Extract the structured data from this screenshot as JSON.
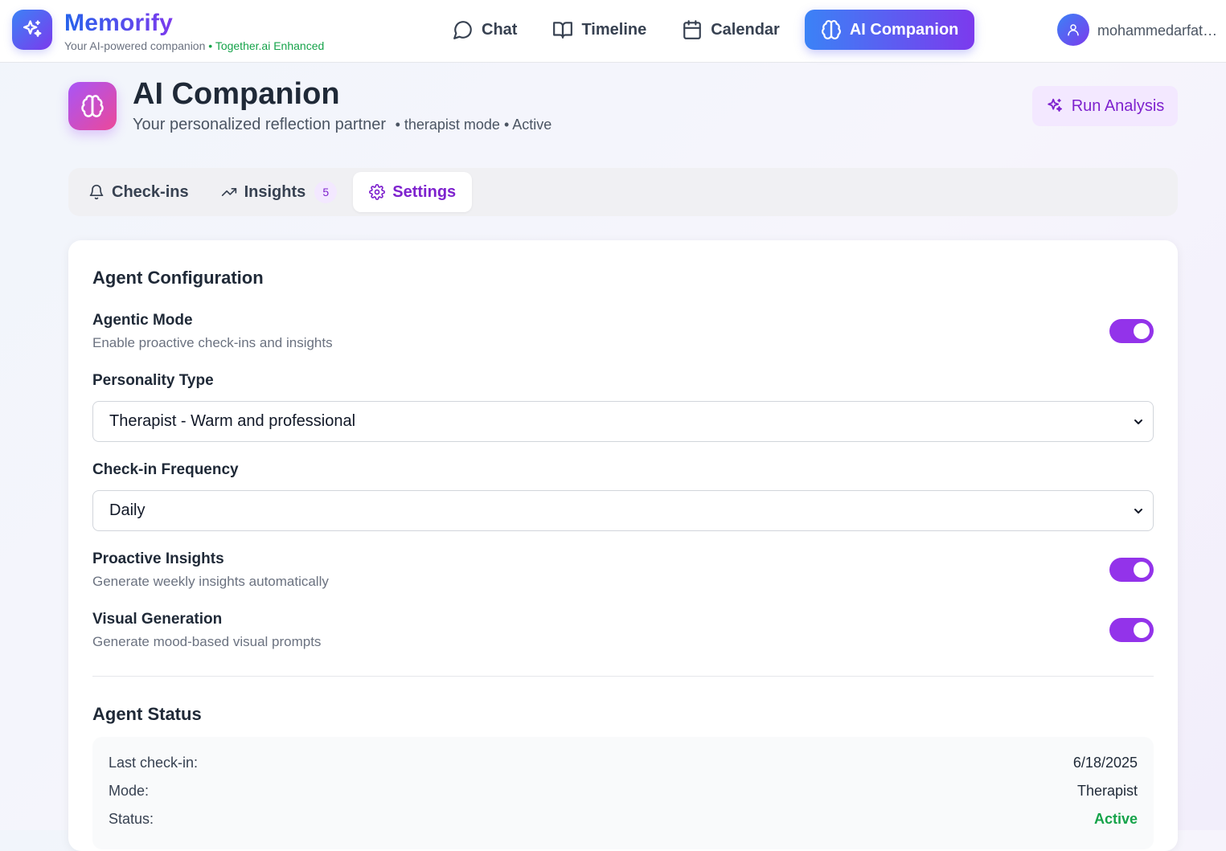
{
  "app": {
    "name": "Memorify",
    "tagline": "Your AI-powered companion",
    "enhanced": "• Together.ai Enhanced"
  },
  "nav": {
    "items": [
      {
        "label": "Chat",
        "icon": "chat-bubble-icon"
      },
      {
        "label": "Timeline",
        "icon": "book-open-icon"
      },
      {
        "label": "Calendar",
        "icon": "calendar-icon"
      },
      {
        "label": "AI Companion",
        "icon": "brain-icon",
        "active": true
      }
    ],
    "user": "mohammedarfath..."
  },
  "page": {
    "title": "AI Companion",
    "subtitle": "Your personalized reflection partner",
    "status": "• therapist mode • Active",
    "run_button": "Run Analysis"
  },
  "tabs": [
    {
      "label": "Check-ins",
      "icon": "bell-icon"
    },
    {
      "label": "Insights",
      "icon": "trending-up-icon",
      "count": "5"
    },
    {
      "label": "Settings",
      "icon": "gear-icon",
      "active": true
    }
  ],
  "config": {
    "title": "Agent Configuration",
    "agentic": {
      "label": "Agentic Mode",
      "desc": "Enable proactive check-ins and insights",
      "on": true
    },
    "personality": {
      "label": "Personality Type",
      "value": "Therapist - Warm and professional"
    },
    "frequency": {
      "label": "Check-in Frequency",
      "value": "Daily"
    },
    "proactive": {
      "label": "Proactive Insights",
      "desc": "Generate weekly insights automatically",
      "on": true
    },
    "visual": {
      "label": "Visual Generation",
      "desc": "Generate mood-based visual prompts",
      "on": true
    }
  },
  "status": {
    "title": "Agent Status",
    "rows": [
      {
        "label": "Last check-in:",
        "value": "6/18/2025"
      },
      {
        "label": "Mode:",
        "value": "Therapist"
      },
      {
        "label": "Status:",
        "value": "Active"
      }
    ]
  },
  "colors": {
    "accent": "#9333ea",
    "brand_gradient_start": "#3b82f6",
    "brand_gradient_end": "#7c3aed",
    "success": "#16a34a"
  }
}
